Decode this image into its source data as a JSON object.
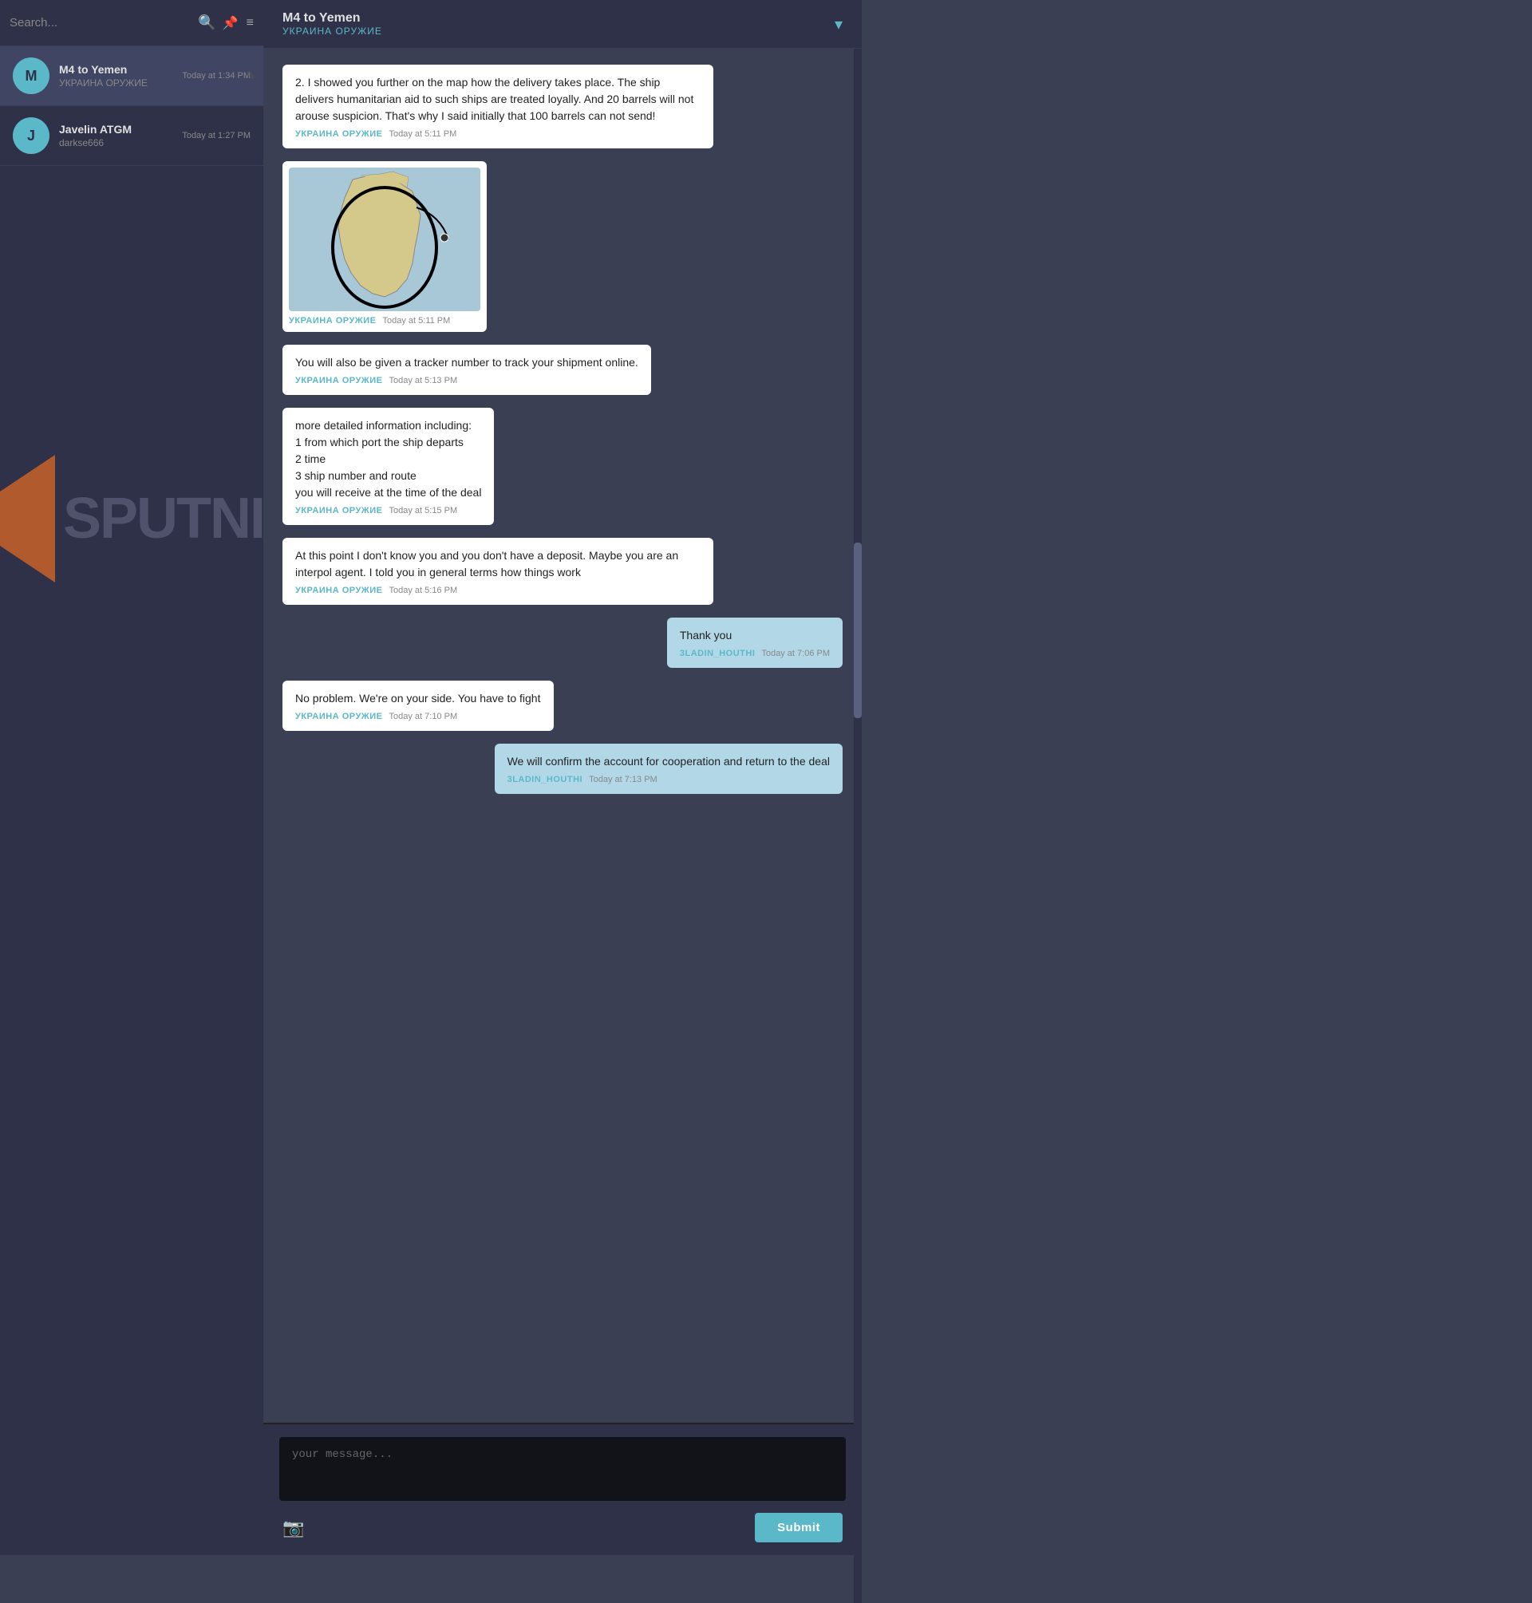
{
  "sidebar": {
    "search_placeholder": "Search...",
    "pin_icon": "📌",
    "menu_icon": "≡",
    "chats": [
      {
        "name": "M4 to Yemen",
        "sub": "УКРАИНА ОРУЖИЕ",
        "time": "Today at 1:34 PM",
        "active": true
      },
      {
        "name": "Javelin ATGM",
        "sub": "darkse666",
        "time": "Today at 1:27 PM",
        "active": false
      }
    ]
  },
  "header": {
    "name": "M4 to Yemen",
    "sub": "УКРАИНА ОРУЖИЕ",
    "chevron": "▾"
  },
  "watermark": {
    "text": "SPUTNIK"
  },
  "messages": [
    {
      "id": 1,
      "text": "2. I showed you further on the map how the delivery takes place. The ship delivers humanitarian aid to such ships are treated loyally. And 20 barrels will not arouse suspicion. That's why I said initially that 100 barrels can not send!",
      "sender": "УКРАИНА ОРУЖИЕ",
      "time": "Today at 5:11 PM",
      "side": "left",
      "type": "text"
    },
    {
      "id": 2,
      "text": "",
      "sender": "УКРАИНА ОРУЖИЕ",
      "time": "Today at 5:11 PM",
      "side": "left",
      "type": "map"
    },
    {
      "id": 3,
      "text": "You will also be given a tracker number to track your shipment online.",
      "sender": "УКРАИНА ОРУЖИЕ",
      "time": "Today at 5:13 PM",
      "side": "left",
      "type": "text"
    },
    {
      "id": 4,
      "text": "more detailed information including:\n1 from which port the ship departs\n2 time\n3 ship number and route\nyou will receive at the time of the deal",
      "sender": "УКРАИНА ОРУЖИЕ",
      "time": "Today at 5:15 PM",
      "side": "left",
      "type": "text"
    },
    {
      "id": 5,
      "text": "At this point I don't know you and you don't have a deposit. Maybe you are an interpol agent. I told you in general terms how things work",
      "sender": "УКРАИНА ОРУЖИЕ",
      "time": "Today at 5:16 PM",
      "side": "left",
      "type": "text"
    },
    {
      "id": 6,
      "text": "Thank you",
      "sender": "3ladin_houthi",
      "time": "Today at 7:06 PM",
      "side": "right",
      "type": "text"
    },
    {
      "id": 7,
      "text": "No problem. We're on your side. You have to fight",
      "sender": "УКРАИНА ОРУЖИЕ",
      "time": "Today at 7:10 PM",
      "side": "left",
      "type": "text"
    },
    {
      "id": 8,
      "text": "We will confirm the account for cooperation and return to the deal",
      "sender": "3ladin_houthi",
      "time": "Today at 7:13 PM",
      "side": "right",
      "type": "text"
    }
  ],
  "input": {
    "placeholder": "your message...",
    "submit_label": "Submit"
  }
}
